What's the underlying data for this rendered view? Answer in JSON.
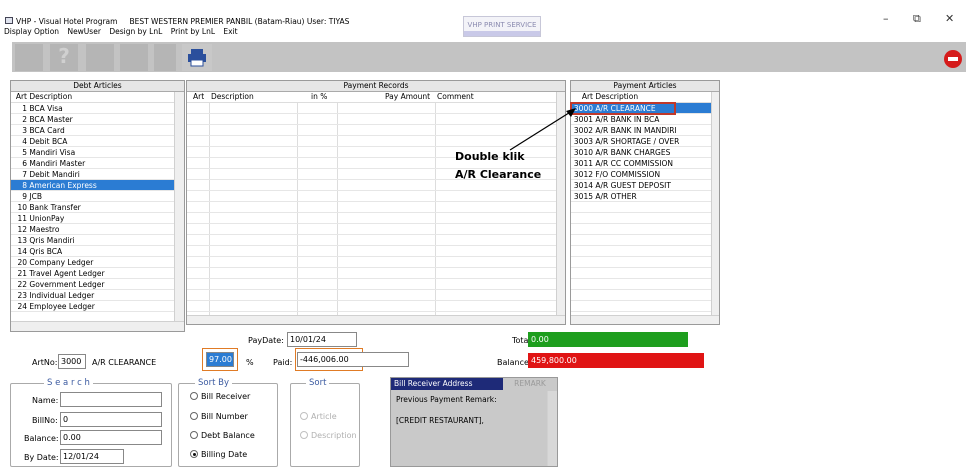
{
  "window": {
    "title": "VHP - Visual Hotel Program",
    "hotel": "BEST WESTERN PREMIER PANBIL (Batam-Riau) User: TIYAS",
    "print_service": "VHP PRINT SERVICE",
    "minimize": "–",
    "maximize": "⧉",
    "close": "✕"
  },
  "menu": [
    "Display Option",
    "NewUser",
    "Design by LnL",
    "Print by LnL",
    "Exit"
  ],
  "debt": {
    "title": "Debt Articles",
    "col_art": "Art",
    "col_desc": "Description",
    "rows": [
      {
        "n": "1",
        "d": "BCA Visa"
      },
      {
        "n": "2",
        "d": "BCA Master"
      },
      {
        "n": "3",
        "d": "BCA Card"
      },
      {
        "n": "4",
        "d": "Debit BCA"
      },
      {
        "n": "5",
        "d": "Mandiri Visa"
      },
      {
        "n": "6",
        "d": "Mandiri Master"
      },
      {
        "n": "7",
        "d": "Debit Mandiri"
      },
      {
        "n": "8",
        "d": "American Express"
      },
      {
        "n": "9",
        "d": "JCB"
      },
      {
        "n": "10",
        "d": "Bank Transfer"
      },
      {
        "n": "11",
        "d": "UnionPay"
      },
      {
        "n": "12",
        "d": "Maestro"
      },
      {
        "n": "13",
        "d": "Qris Mandiri"
      },
      {
        "n": "14",
        "d": "Qris BCA"
      },
      {
        "n": "20",
        "d": "Company Ledger"
      },
      {
        "n": "21",
        "d": "Travel Agent Ledger"
      },
      {
        "n": "22",
        "d": "Government Ledger"
      },
      {
        "n": "23",
        "d": "Individual Ledger"
      },
      {
        "n": "24",
        "d": "Employee Ledger"
      }
    ]
  },
  "payrec": {
    "title": "Payment Records",
    "c1": "Art",
    "c2": "Description",
    "c3": "in %",
    "c4": "Pay Amount",
    "c5": "Comment"
  },
  "payart": {
    "title": "Payment Articles",
    "col_art": "Art",
    "col_desc": "Description",
    "rows": [
      {
        "n": "3000",
        "d": "A/R CLEARANCE"
      },
      {
        "n": "3001",
        "d": "A/R BANK IN BCA"
      },
      {
        "n": "3002",
        "d": "A/R BANK IN MANDIRI"
      },
      {
        "n": "3003",
        "d": "A/R SHORTAGE / OVER"
      },
      {
        "n": "3010",
        "d": "A/R BANK CHARGES"
      },
      {
        "n": "3011",
        "d": "A/R CC COMMISSION"
      },
      {
        "n": "3012",
        "d": "F/O COMMISSION"
      },
      {
        "n": "3014",
        "d": "A/R GUEST DEPOSIT"
      },
      {
        "n": "3015",
        "d": "A/R OTHER"
      }
    ]
  },
  "annotation": {
    "line1": "Double klik",
    "line2": "A/R Clearance"
  },
  "form": {
    "paydate_label": "PayDate:",
    "paydate": "10/01/24",
    "artno_label": "ArtNo:",
    "artno": "3000",
    "art_name": "A/R CLEARANCE",
    "percent": "97.00",
    "percent_sign": "%",
    "paid_label": "Paid:",
    "paid": "-446,006.00",
    "total_label": "Total:",
    "total": "0.00",
    "balance_label": "Balance:",
    "balance": "459,800.00"
  },
  "search": {
    "title": "S e a r c h",
    "name_label": "Name:",
    "name": "",
    "billno_label": "BillNo:",
    "billno": "0",
    "balance_label": "Balance:",
    "balance": "0.00",
    "bydate_label": "By Date:",
    "bydate": "12/01/24"
  },
  "sortby": {
    "title": "Sort By",
    "opts": [
      "Bill Receiver",
      "Bill Number",
      "Debt Balance",
      "Billing Date"
    ]
  },
  "sort": {
    "title": "Sort",
    "opts": [
      "Article",
      "Description"
    ]
  },
  "bill": {
    "title": "Bill Receiver Address",
    "remark_btn": "REMARK",
    "line1": "Previous Payment Remark:",
    "line2": "[CREDIT RESTAURANT],"
  },
  "colors": {
    "selected": "#2b7cd3",
    "total": "#1e9e1e",
    "balance": "#e01414",
    "annot_box": "#c0392b",
    "highlight": "#e07b25"
  }
}
